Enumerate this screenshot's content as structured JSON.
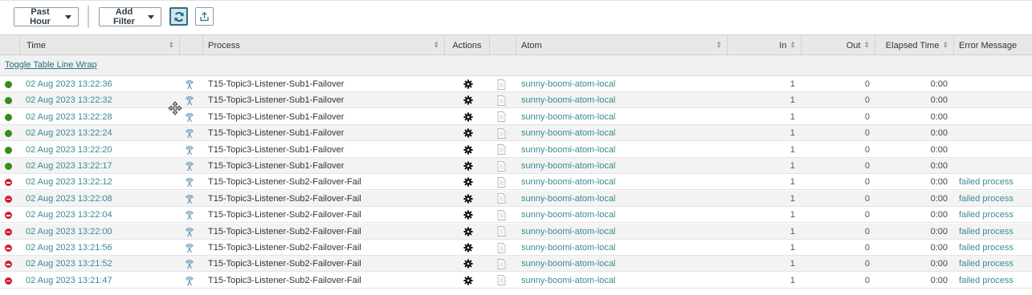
{
  "toolbar": {
    "time_filter": "Past Hour",
    "add_filter": "Add Filter"
  },
  "columns": {
    "time": "Time",
    "process": "Process",
    "actions": "Actions",
    "atom": "Atom",
    "in": "In",
    "out": "Out",
    "elapsed": "Elapsed Time",
    "error": "Error Message"
  },
  "toggle_wrap": "Toggle Table Line Wrap",
  "colors": {
    "success": "#3a8a1e",
    "error": "#cf1f2a",
    "link": "#3b8a93",
    "accent": "#2d6e86"
  },
  "rows": [
    {
      "status": "success",
      "time": "02 Aug 2023 13:22:36",
      "process": "T15-Topic3-Listener-Sub1-Failover",
      "atom": "sunny-boomi-atom-local",
      "in": "1",
      "out": "0",
      "elapsed": "0:00",
      "error": ""
    },
    {
      "status": "success",
      "time": "02 Aug 2023 13:22:32",
      "process": "T15-Topic3-Listener-Sub1-Failover",
      "atom": "sunny-boomi-atom-local",
      "in": "1",
      "out": "0",
      "elapsed": "0:00",
      "error": ""
    },
    {
      "status": "success",
      "time": "02 Aug 2023 13:22:28",
      "process": "T15-Topic3-Listener-Sub1-Failover",
      "atom": "sunny-boomi-atom-local",
      "in": "1",
      "out": "0",
      "elapsed": "0:00",
      "error": ""
    },
    {
      "status": "success",
      "time": "02 Aug 2023 13:22:24",
      "process": "T15-Topic3-Listener-Sub1-Failover",
      "atom": "sunny-boomi-atom-local",
      "in": "1",
      "out": "0",
      "elapsed": "0:00",
      "error": ""
    },
    {
      "status": "success",
      "time": "02 Aug 2023 13:22:20",
      "process": "T15-Topic3-Listener-Sub1-Failover",
      "atom": "sunny-boomi-atom-local",
      "in": "1",
      "out": "0",
      "elapsed": "0:00",
      "error": ""
    },
    {
      "status": "success",
      "time": "02 Aug 2023 13:22:17",
      "process": "T15-Topic3-Listener-Sub1-Failover",
      "atom": "sunny-boomi-atom-local",
      "in": "1",
      "out": "0",
      "elapsed": "0:00",
      "error": ""
    },
    {
      "status": "error",
      "time": "02 Aug 2023 13:22:12",
      "process": "T15-Topic3-Listener-Sub2-Failover-Fail",
      "atom": "sunny-boomi-atom-local",
      "in": "1",
      "out": "0",
      "elapsed": "0:00",
      "error": "failed process"
    },
    {
      "status": "error",
      "time": "02 Aug 2023 13:22:08",
      "process": "T15-Topic3-Listener-Sub2-Failover-Fail",
      "atom": "sunny-boomi-atom-local",
      "in": "1",
      "out": "0",
      "elapsed": "0:00",
      "error": "failed process"
    },
    {
      "status": "error",
      "time": "02 Aug 2023 13:22:04",
      "process": "T15-Topic3-Listener-Sub2-Failover-Fail",
      "atom": "sunny-boomi-atom-local",
      "in": "1",
      "out": "0",
      "elapsed": "0:00",
      "error": "failed process"
    },
    {
      "status": "error",
      "time": "02 Aug 2023 13:22:00",
      "process": "T15-Topic3-Listener-Sub2-Failover-Fail",
      "atom": "sunny-boomi-atom-local",
      "in": "1",
      "out": "0",
      "elapsed": "0:00",
      "error": "failed process"
    },
    {
      "status": "error",
      "time": "02 Aug 2023 13:21:56",
      "process": "T15-Topic3-Listener-Sub2-Failover-Fail",
      "atom": "sunny-boomi-atom-local",
      "in": "1",
      "out": "0",
      "elapsed": "0:00",
      "error": "failed process"
    },
    {
      "status": "error",
      "time": "02 Aug 2023 13:21:52",
      "process": "T15-Topic3-Listener-Sub2-Failover-Fail",
      "atom": "sunny-boomi-atom-local",
      "in": "1",
      "out": "0",
      "elapsed": "0:00",
      "error": "failed process"
    },
    {
      "status": "error",
      "time": "02 Aug 2023 13:21:47",
      "process": "T15-Topic3-Listener-Sub2-Failover-Fail",
      "atom": "sunny-boomi-atom-local",
      "in": "1",
      "out": "0",
      "elapsed": "0:00",
      "error": "failed process"
    }
  ]
}
